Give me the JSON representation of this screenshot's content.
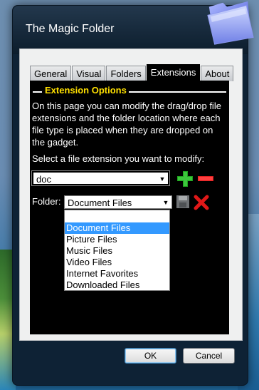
{
  "window": {
    "title": "The Magic Folder"
  },
  "tabs": [
    {
      "label": "General"
    },
    {
      "label": "Visual"
    },
    {
      "label": "Folders"
    },
    {
      "label": "Extensions",
      "active": true
    },
    {
      "label": "About"
    }
  ],
  "section": {
    "title": "Extension Options",
    "description": "On this page you can modify the drag/drop file extensions and the folder location where each file type is placed when they are dropped on the gadget.",
    "prompt": "Select a file extension you want to modify:"
  },
  "extension_select": {
    "value": "doc"
  },
  "folder": {
    "label": "Folder:",
    "value": "Document Files",
    "options": [
      "",
      "Document Files",
      "Picture Files",
      "Music Files",
      "Video Files",
      "Internet Favorites",
      "Downloaded Files"
    ],
    "selected_option": "Document Files"
  },
  "buttons": {
    "ok": "OK",
    "cancel": "Cancel"
  },
  "icons": {
    "add": "plus-icon",
    "remove": "minus-icon",
    "save": "floppy-disk-icon",
    "delete": "red-x-icon",
    "app": "folder-icon",
    "dropdown": "chevron-down-icon"
  },
  "colors": {
    "section_title": "#ffe000",
    "highlight": "#3399ff",
    "add": "#1ea21e",
    "remove": "#e02020"
  }
}
